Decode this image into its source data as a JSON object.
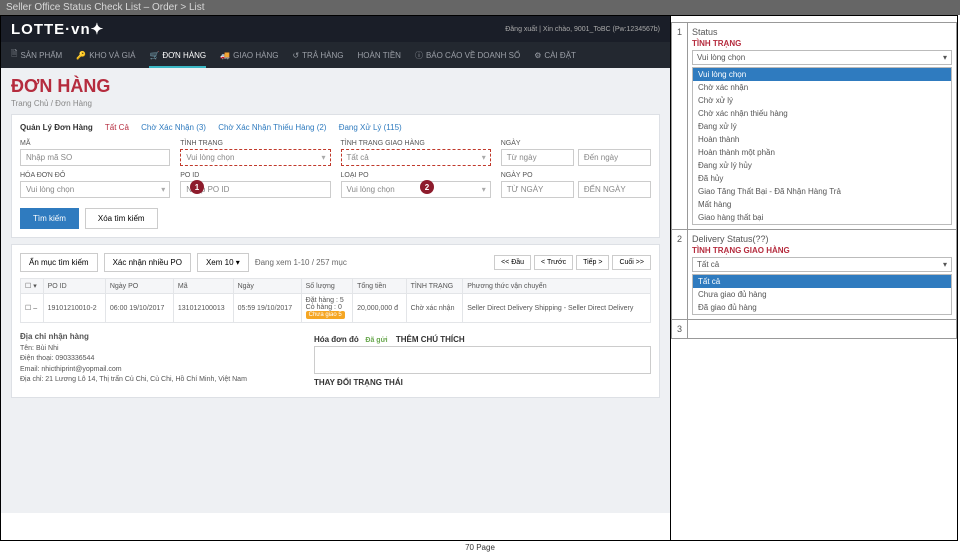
{
  "titlebar": "Seller Office Status Check List – Order > List",
  "logo": "LOTTE·vn",
  "user_info": "Đăng xuất | Xin chào, 9001_ToBC (Pw:1234567b)",
  "nav": {
    "items": [
      "SẢN PHẨM",
      "KHO VÀ GIÁ",
      "ĐƠN HÀNG",
      "GIAO HÀNG",
      "TRẢ HÀNG",
      "HOÀN TIỀN",
      "BÁO CÁO VỀ DOANH SỐ",
      "CÀI ĐẶT"
    ]
  },
  "page": {
    "title": "ĐƠN HÀNG",
    "breadcrumb": "Trang Chủ / Đơn Hàng"
  },
  "tabs": {
    "label": "Quản Lý Đơn Hàng",
    "all": "Tất Cả",
    "t1": "Chờ Xác Nhận (3)",
    "t2": "Chờ Xác Nhận Thiếu Hàng (2)",
    "t3": "Đang Xử Lý (115)"
  },
  "filters": {
    "ma": {
      "label": "MÃ",
      "ph": "Nhập mã SO"
    },
    "status": {
      "label": "TÌNH TRẠNG",
      "val": "Vui lòng chọn"
    },
    "delivery": {
      "label": "TÌNH TRẠNG GIAO HÀNG",
      "val": "Tất cả"
    },
    "ngay": {
      "label": "NGÀY",
      "from": "Từ ngày",
      "to": "Đến ngày"
    },
    "hoadon": {
      "label": "HÓA ĐƠN ĐỎ",
      "val": "Vui lòng chọn"
    },
    "poid": {
      "label": "PO ID",
      "ph": "Nhập PO ID"
    },
    "loaipo": {
      "label": "LOẠI PO",
      "val": "Vui lòng chọn"
    },
    "ngaypo": {
      "label": "NGÀY PO",
      "from": "TỪ NGÀY",
      "to": "ĐẾN NGÀY"
    }
  },
  "buttons": {
    "search": "Tìm kiếm",
    "clear": "Xóa tìm kiếm",
    "hide": "Ẩn mục tìm kiếm",
    "confirm": "Xác nhận nhiều PO",
    "view": "Xem",
    "viewn": "10",
    "count": "Đang xem 1-10 / 257 mục",
    "first": "<< Đầu",
    "prev": "< Trước",
    "next": "Tiếp >",
    "last": "Cuối >>"
  },
  "table": {
    "headers": [
      "",
      "PO ID",
      "Ngày PO",
      "Mã",
      "Ngày",
      "Số lượng",
      "Tổng tiền",
      "TÌNH TRẠNG",
      "Phương thức vận chuyển"
    ],
    "row": {
      "poid": "19101210010-2",
      "ngaypo": "06:00 19/10/2017",
      "ma": "131012100013",
      "ngay": "05:59 19/10/2017",
      "sl1": "Đặt hàng : 5",
      "sl2": "Cò hàng : 0",
      "badge": "Chưa giao 5",
      "tong": "20,000,000 đ",
      "tt": "Chờ xác nhận",
      "ship": "Seller Direct Delivery Shipping - Seller Direct Delivery"
    }
  },
  "addr": {
    "title": "Địa chỉ nhận hàng",
    "name": "Tên: Bùi Nhi",
    "phone": "Điện thoại: 0903336544",
    "email": "Email: nhicthiprint@yopmail.com",
    "full": "Địa chỉ: 21 Lương Lô 14, Thị trấn Củ Chi, Củ Chi, Hồ Chí Minh, Việt Nam"
  },
  "note": {
    "hd": "Hóa đơn đỏ",
    "sent": "Đã gửi",
    "add": "THÊM CHÚ THÍCH",
    "state": "THAY ĐỔI TRẠNG THÁI"
  },
  "r1": {
    "num": "1",
    "title": "Status",
    "label": "TÌNH TRẠNG",
    "sel": "Vui lòng chọn",
    "opts": [
      "Vui lòng chọn",
      "Chờ xác nhận",
      "Chờ xử lý",
      "Chờ xác nhận thiếu hàng",
      "Đang xử lý",
      "Hoàn thành",
      "Hoàn thành một phần",
      "Đang xử lý hủy",
      "Đã hủy",
      "Giao Tăng Thất Bại - Đã Nhận Hàng Trả",
      "Mất hàng",
      "Giao hàng thất bại"
    ]
  },
  "r2": {
    "num": "2",
    "title": "Delivery Status(??)",
    "label": "TÌNH TRẠNG GIAO HÀNG",
    "sel": "Tất cả",
    "opts": [
      "Tất cả",
      "Chưa giao đủ hàng",
      "Đã giao đủ hàng"
    ]
  },
  "r3": {
    "num": "3"
  },
  "footer": "70 Page"
}
